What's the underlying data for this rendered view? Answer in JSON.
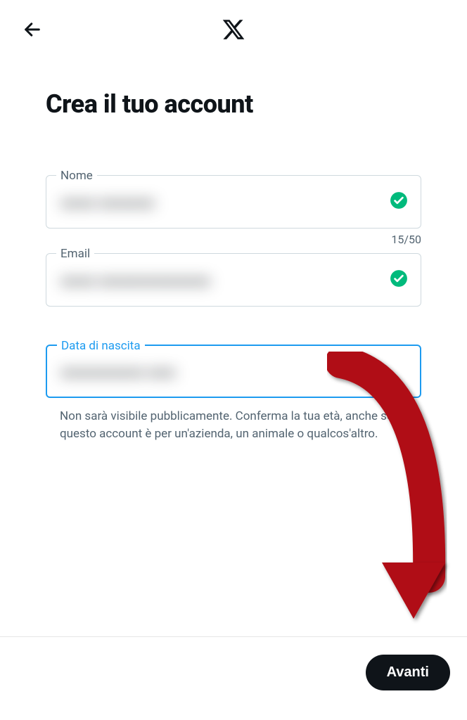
{
  "header": {
    "back_aria": "Indietro"
  },
  "title": "Crea il tuo account",
  "fields": {
    "name": {
      "label": "Nome",
      "value": "xxxxx xxxxxxxx",
      "counter": "15/50",
      "valid": true
    },
    "email": {
      "label": "Email",
      "value": "xxxxx xxxxxxxxxxxxxxxx",
      "valid": true
    },
    "dob": {
      "label": "Data di nascita",
      "value": "xxxxxxxxxxxx xxxx",
      "hint": "Non sarà visibile pubblicamente. Conferma la tua età, anche se questo account è per un'azienda, un animale o qualcos'altro."
    }
  },
  "footer": {
    "next_label": "Avanti"
  }
}
